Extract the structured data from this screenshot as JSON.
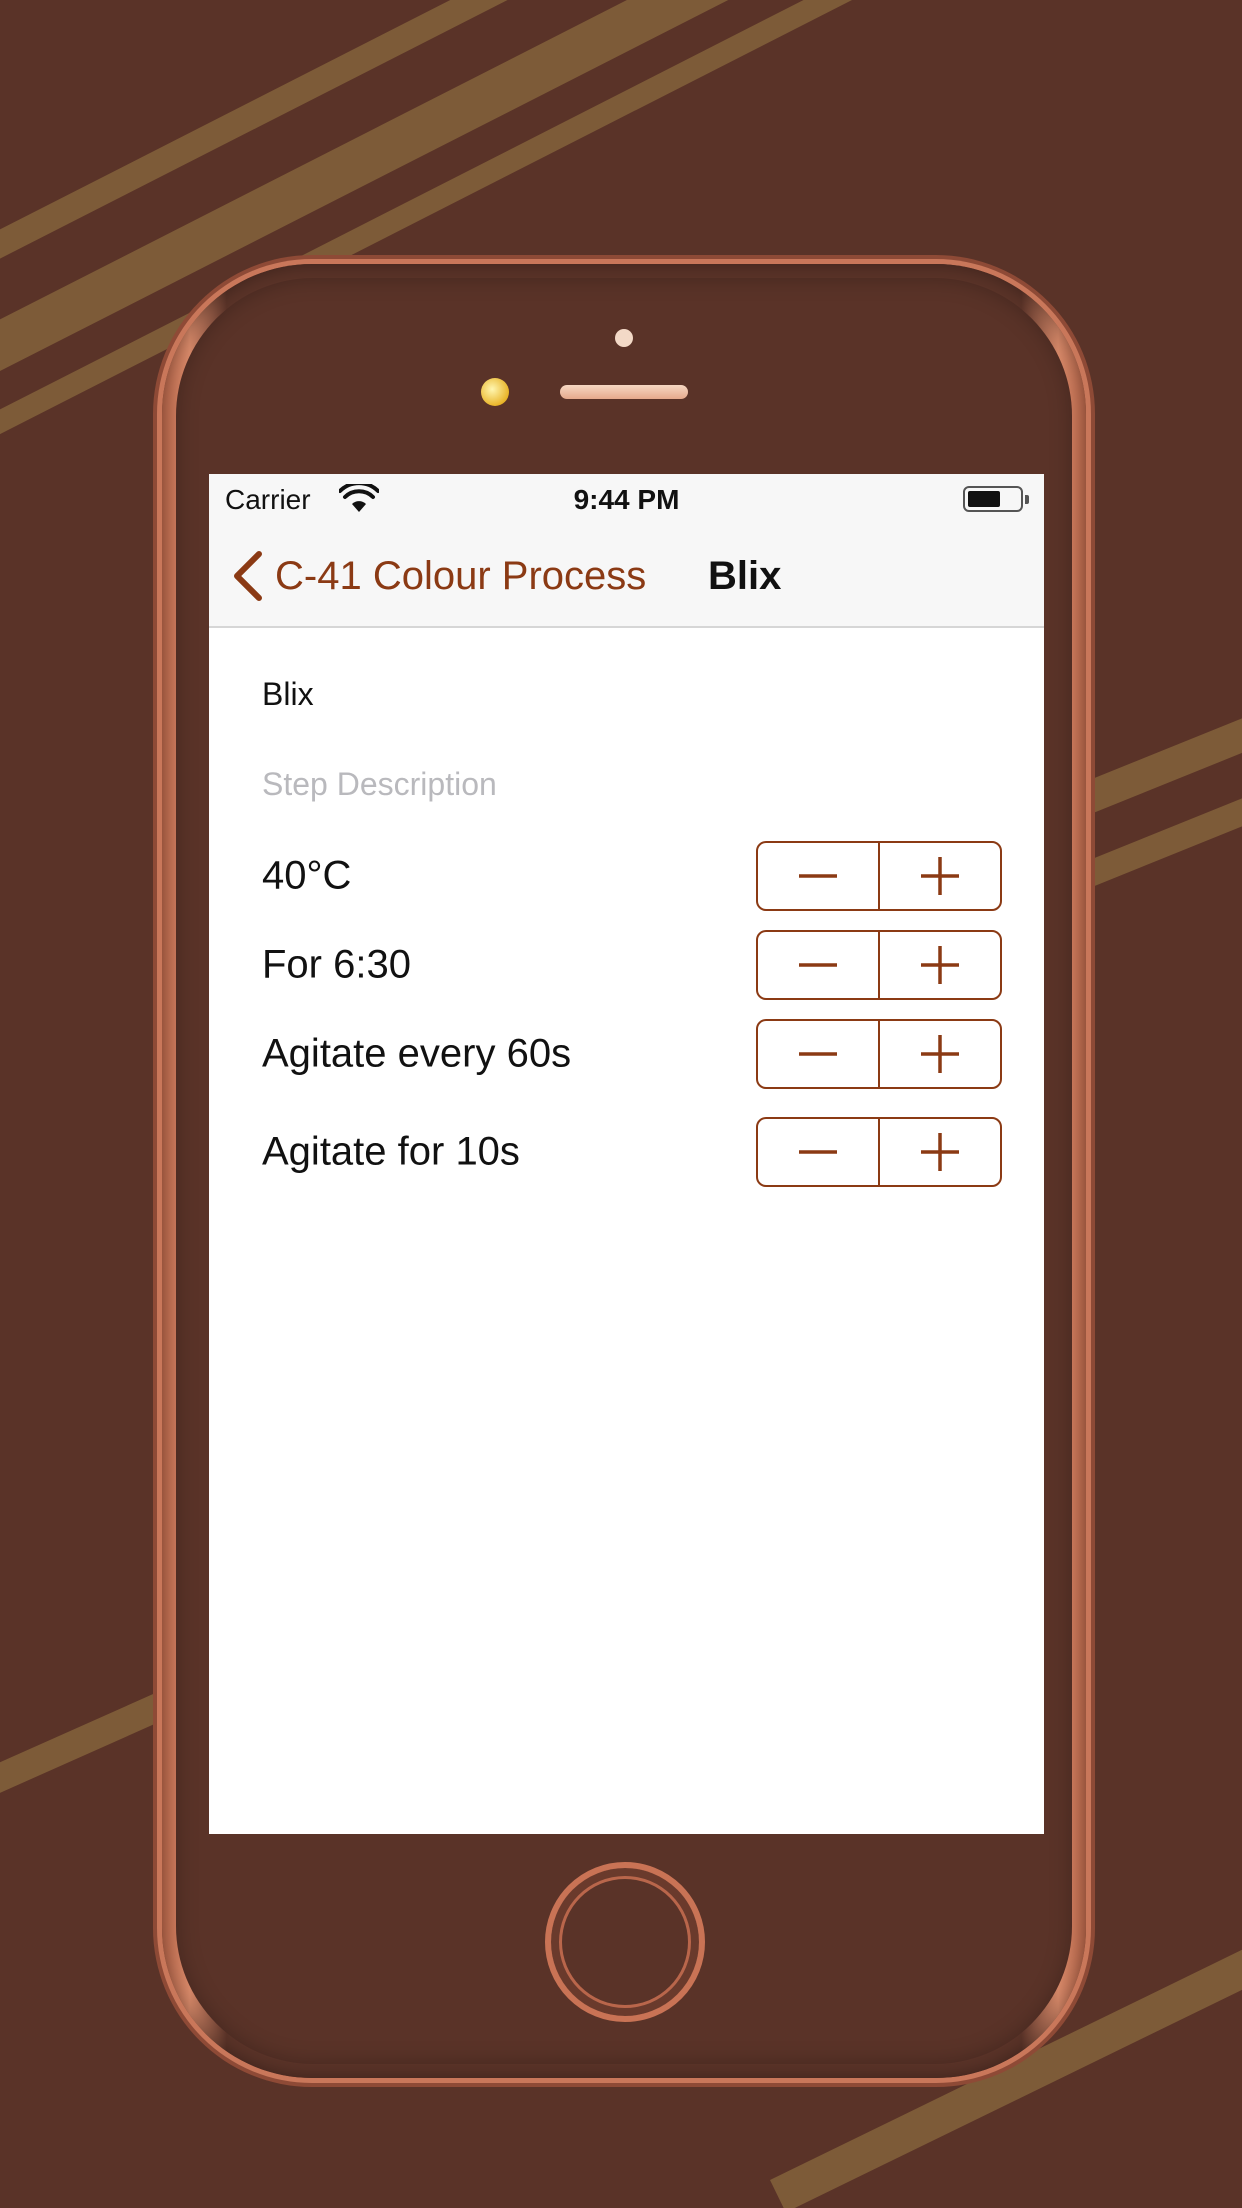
{
  "status_bar": {
    "carrier": "Carrier",
    "time": "9:44 PM"
  },
  "nav": {
    "back_label": "C-41 Colour Process",
    "title": "Blix"
  },
  "step": {
    "name": "Blix",
    "description_placeholder": "Step Description"
  },
  "settings": [
    {
      "label": "40°C"
    },
    {
      "label": "For 6:30"
    },
    {
      "label": "Agitate every 60s"
    },
    {
      "label": "Agitate for 10s"
    }
  ],
  "colors": {
    "accent": "#8b3a14",
    "background": "#5a3328",
    "stripe": "#8a6a3e"
  },
  "icons": {
    "back": "chevron-left-icon",
    "decrement": "minus-icon",
    "increment": "plus-icon"
  }
}
